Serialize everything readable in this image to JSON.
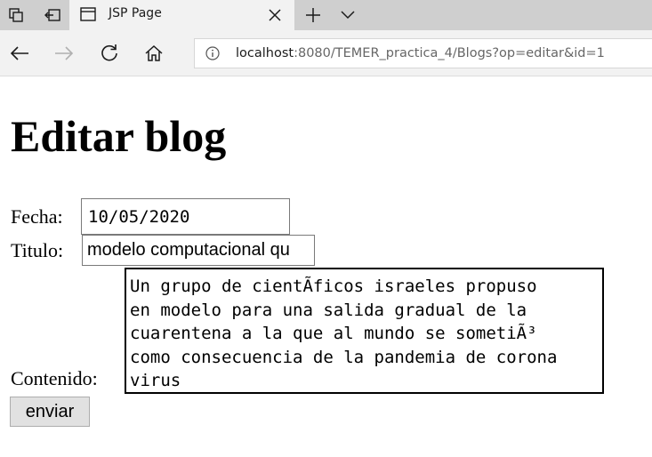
{
  "browser": {
    "tab": {
      "title": "JSP Page"
    },
    "address": {
      "host": "localhost",
      "path": ":8080/TEMER_practica_4/Blogs?op=editar&id=1"
    }
  },
  "page": {
    "title": "Editar blog",
    "form": {
      "fecha_label": "Fecha:",
      "fecha_value": "10/05/2020",
      "titulo_label": "Titulo:",
      "titulo_value": "modelo computacional qu",
      "contenido_label": "Contenido:",
      "contenido_value": "Un grupo de cientÃficos israeles propuso\nen modelo para una salida gradual de la\ncuarentena a la que al mundo se sometiÃ³\ncomo consecuencia de la pandemia de corona\nvirus",
      "submit_label": "enviar"
    }
  }
}
